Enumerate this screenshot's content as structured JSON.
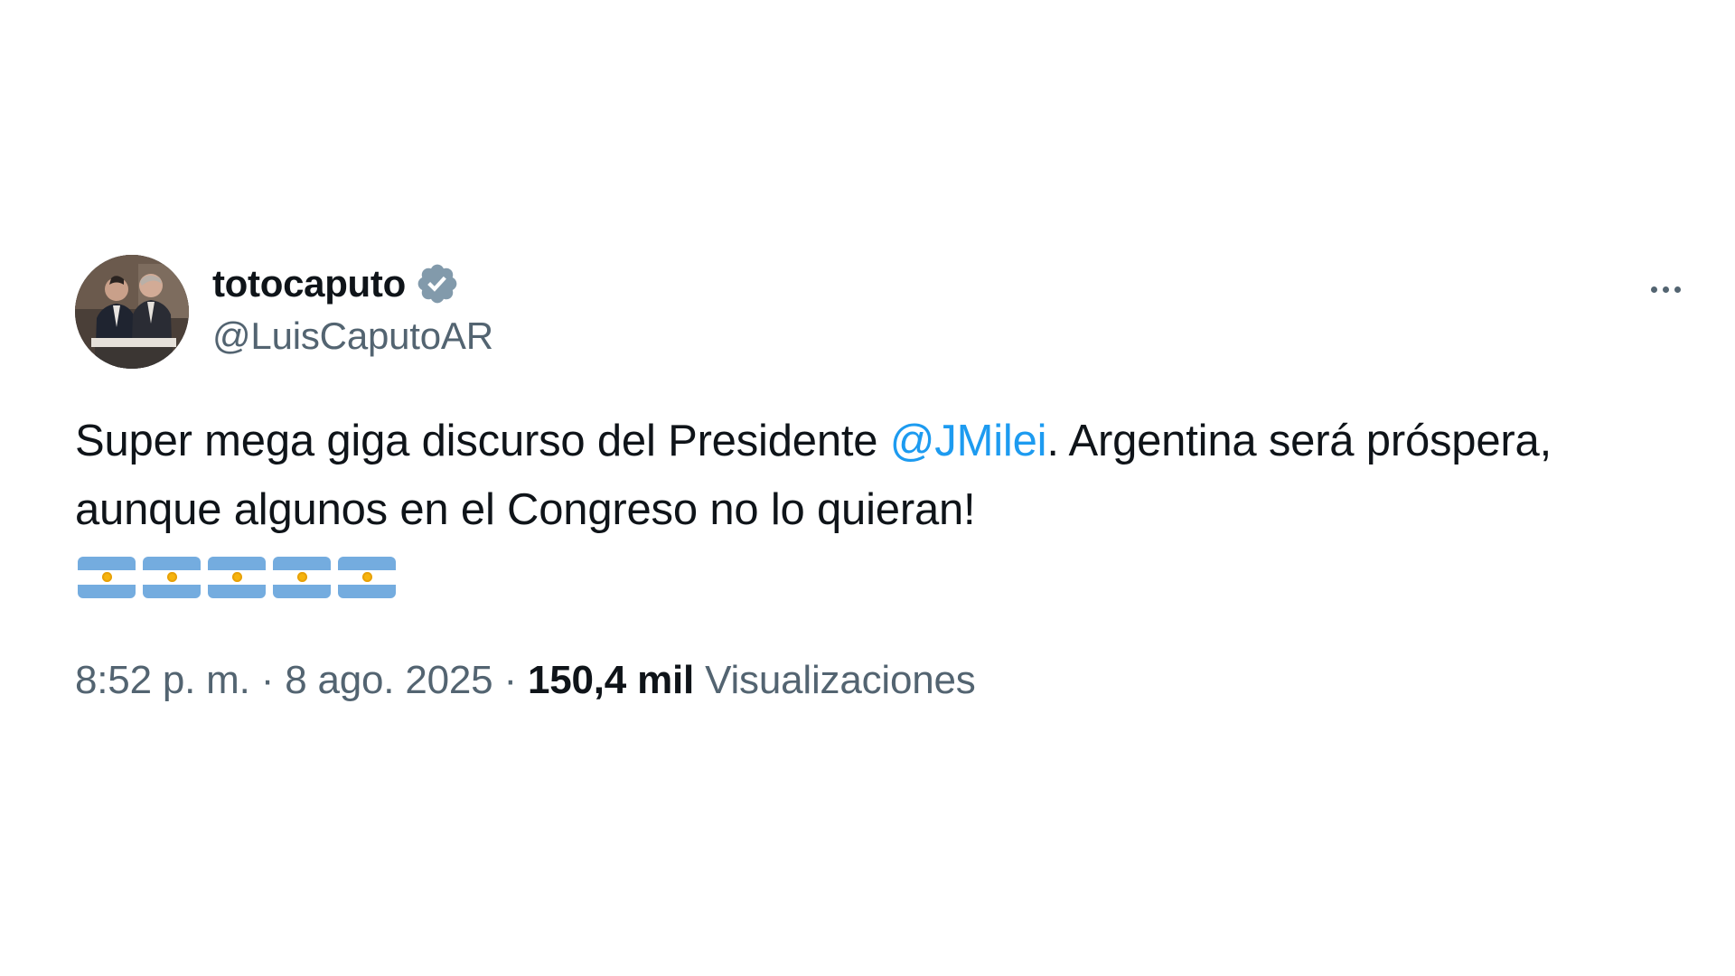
{
  "tweet": {
    "display_name": "totocaputo",
    "handle": "@LuisCaputoAR",
    "verified": true,
    "verified_badge_color": "#829aab",
    "text_part1": "Super mega giga discurso del Presidente ",
    "mention": "@JMilei",
    "text_part2": ". Argentina será próspera, aunque algunos en el Congreso no lo quieran!",
    "flag_emoji_count": 5,
    "flag_emoji": "🇦🇷",
    "time": "8:52 p. m.",
    "separator": "·",
    "date": "8 ago. 2025",
    "views_count": "150,4 mil",
    "views_label": "Visualizaciones",
    "more_icon": "more-horizontal-icon"
  },
  "colors": {
    "text_primary": "#0f1419",
    "text_secondary": "#536471",
    "link": "#1d9bf0",
    "background": "#ffffff"
  }
}
